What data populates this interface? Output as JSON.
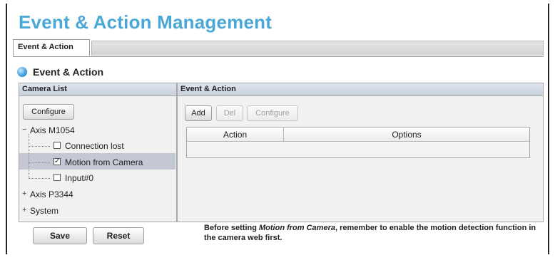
{
  "page_title": "Event & Action Management",
  "tabs": [
    {
      "label": "Event & Action"
    }
  ],
  "section": {
    "label": "Event & Action"
  },
  "camera_list": {
    "header": "Camera List",
    "configure_label": "Configure",
    "tree": [
      {
        "label": "Axis M1054",
        "expanded": true,
        "children": [
          {
            "label": "Connection lost",
            "checked": false
          },
          {
            "label": "Motion from Camera",
            "checked": true,
            "selected": true
          },
          {
            "label": "Input#0",
            "checked": false
          }
        ]
      },
      {
        "label": "Axis P3344",
        "expanded": false
      },
      {
        "label": "System",
        "expanded": false
      }
    ]
  },
  "event_action": {
    "header": "Event & Action",
    "buttons": {
      "add": "Add",
      "del": "Del",
      "configure": "Configure"
    },
    "columns": [
      "Action",
      "Options"
    ]
  },
  "footer": {
    "save_label": "Save",
    "reset_label": "Reset",
    "note_pre": "Before setting ",
    "note_em": "Motion from Camera",
    "note_post": ", remember to enable the motion detection function in the camera web first."
  },
  "colors": {
    "title": "#4aa8d8",
    "selected_row": "#c3c8d4"
  }
}
